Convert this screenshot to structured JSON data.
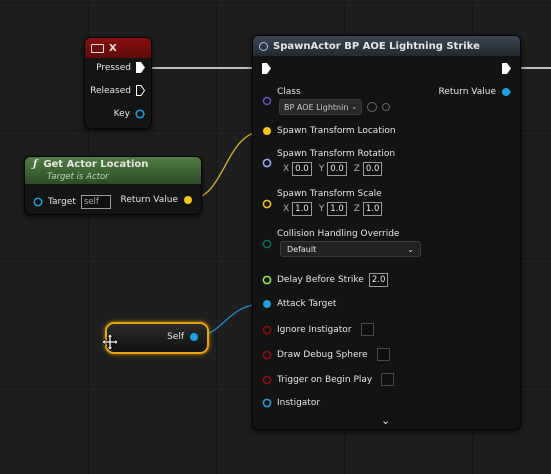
{
  "key_node": {
    "title": "X",
    "pressed": "Pressed",
    "released": "Released",
    "key": "Key"
  },
  "get_actor_location": {
    "title": "Get Actor Location",
    "subtitle": "Target is Actor",
    "target_label": "Target",
    "target_value": "self",
    "return_value": "Return Value"
  },
  "self_node": {
    "label": "Self"
  },
  "spawn": {
    "title": "SpawnActor BP AOE Lightning Strike",
    "class_label": "Class",
    "class_value": "BP AOE Lightnin",
    "return_value": "Return Value",
    "spawn_transform_location": "Spawn Transform Location",
    "rotation": {
      "label": "Spawn Transform Rotation",
      "x_label": "X",
      "x": "0.0",
      "y_label": "Y",
      "y": "0.0",
      "z_label": "Z",
      "z": "0.0"
    },
    "scale": {
      "label": "Spawn Transform Scale",
      "x_label": "X",
      "x": "1.0",
      "y_label": "Y",
      "y": "1.0",
      "z_label": "Z",
      "z": "1.0"
    },
    "collision_label": "Collision Handling Override",
    "collision_value": "Default",
    "delay_label": "Delay Before Strike",
    "delay_value": "2.0",
    "attack_target": "Attack Target",
    "ignore_instigator": "Ignore Instigator",
    "draw_debug_sphere": "Draw Debug Sphere",
    "trigger_on_begin_play": "Trigger on Begin Play",
    "instigator": "Instigator"
  },
  "colors": {
    "exec": "#ffffff",
    "object": "#1f9fe0",
    "vector": "#f5c518",
    "rotator": "#9aaeff",
    "bool": "#8c0f0f",
    "byte": "#0c6b55",
    "float": "#93f53a",
    "key_header": "#7a0e0e",
    "func_header": "#4b7a3d",
    "spawn_header": "#2f3a44"
  },
  "icons": [
    "keyboard-icon",
    "function-icon",
    "spawn-icon",
    "chevron-down-icon",
    "move-cursor-icon"
  ]
}
